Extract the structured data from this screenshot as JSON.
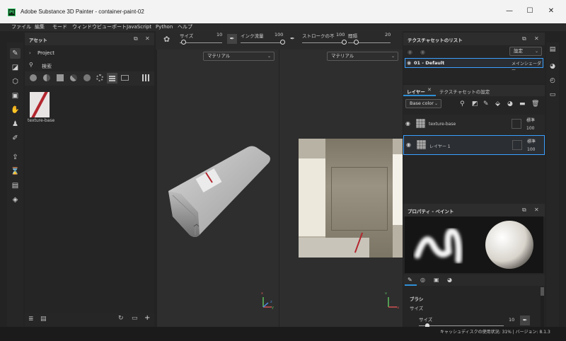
{
  "window": {
    "app_icon": "Pt",
    "title": "Adobe Substance 3D Painter - container-paint-02",
    "minimize": "—",
    "maximize": "☐",
    "close": "✕"
  },
  "menu": [
    "ファイル",
    "編集",
    "モード",
    "ウィンドウ",
    "ビューポート",
    "JavaScript",
    "Python",
    "ヘルプ"
  ],
  "left_toolbar_icons": [
    "paint-brush-icon",
    "eraser-icon",
    "projection-icon",
    "polygon-fill-icon",
    "smudge-icon",
    "clone-icon",
    "color-picker-icon",
    "export-icon",
    "bake-icon",
    "shelf-icon",
    "mesh-icon"
  ],
  "assets": {
    "title": "アセット",
    "project_label": "Project",
    "search_placeholder": "検索",
    "asset_items": [
      {
        "name": "texture-base"
      }
    ]
  },
  "tool_options": {
    "size_label": "サイズ",
    "size_value": "10",
    "size_level": 0.1,
    "ink_flow_label": "インク流量",
    "ink_flow_value": "100",
    "ink_flow_level": 1.0,
    "stroke_label": "ストロークの不",
    "stroke_value": "100",
    "stroke_level": 1.0,
    "spacing_label": "間隔",
    "spacing_value": "20",
    "spacing_level": 0.2
  },
  "viewports": {
    "left_dropdown": "マテリアル",
    "right_dropdown": "マテリアル",
    "axis_x": "x",
    "axis_y": "y",
    "axis_z": "z",
    "axis_u": "u",
    "axis_v": "v"
  },
  "texture_sets": {
    "title": "テクスチャセットのリスト",
    "settings_label": "設定",
    "set_name": "01 - Default",
    "shader_label": "メインシェーダー"
  },
  "layers": {
    "tab_layers": "レイヤー",
    "tab_settings": "テクスチャセットの設定",
    "channel_dropdown": "Base color",
    "rows": [
      {
        "name": "texture-base",
        "blend": "標準",
        "opacity": "100"
      },
      {
        "name": "レイヤー 1",
        "blend": "標準",
        "opacity": "100"
      }
    ]
  },
  "properties": {
    "title": "プロパティ - ペイント",
    "section_brush": "ブラシ",
    "size_label": "サイズ",
    "sub_size_label": "サイズ",
    "sub_size_value": "10",
    "sub_size_level": 0.1
  },
  "status": {
    "text": "キャッシュディスクの使用状況: 31% | バージョン: 8.1.3"
  },
  "colors": {
    "accent": "#2f8fd6",
    "highlight_border": "#3aa0ff",
    "red_stroke": "#b3262e"
  }
}
